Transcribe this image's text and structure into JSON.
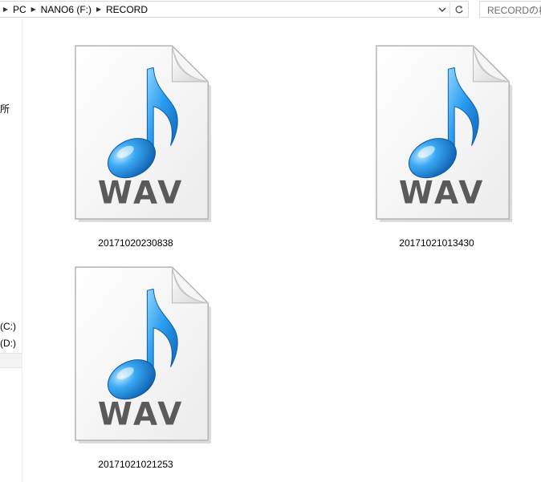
{
  "breadcrumb": {
    "items": [
      "PC",
      "NANO6 (F:)",
      "RECORD"
    ]
  },
  "search": {
    "placeholder": "RECORDの検"
  },
  "nav": {
    "fragment_1": "所",
    "drive_c": "(C:)",
    "drive_d": "(D:)"
  },
  "icons": {
    "file_type_text": "WAV",
    "note_color": "#1e88d8"
  },
  "files": [
    {
      "name": "20171020230838"
    },
    {
      "name": "20171021013430"
    },
    {
      "name": "20171021021253"
    }
  ]
}
